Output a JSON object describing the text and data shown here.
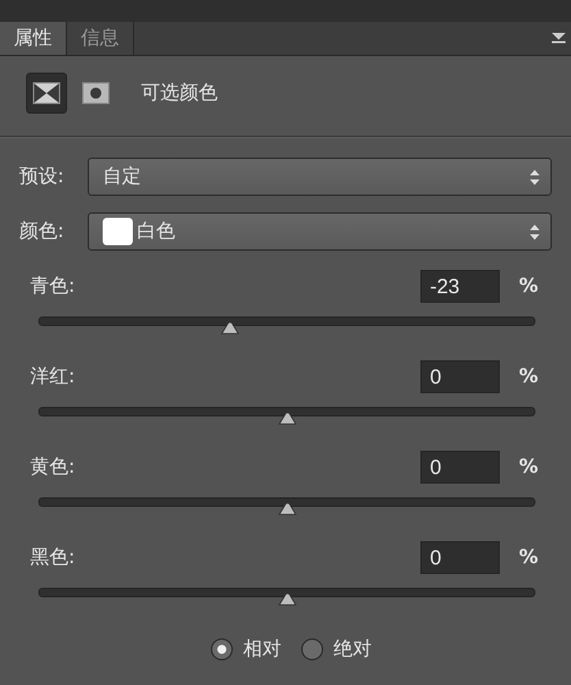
{
  "tabs": [
    {
      "label": "属性",
      "selected": true
    },
    {
      "label": "信息",
      "selected": false
    }
  ],
  "header": {
    "modes": [
      {
        "kind": "adjustment",
        "selected": true
      },
      {
        "kind": "mask",
        "selected": false
      }
    ],
    "title": "可选颜色"
  },
  "preset": {
    "label": "预设:",
    "value": "自定"
  },
  "colors": {
    "label": "颜色:",
    "value": "白色"
  },
  "sliders": [
    {
      "name": "青色:",
      "value": "-23",
      "unit": "%",
      "level": 0.385
    },
    {
      "name": "洋红:",
      "value": "0",
      "unit": "%",
      "level": 0.5
    },
    {
      "name": "黄色:",
      "value": "0",
      "unit": "%",
      "level": 0.5
    },
    {
      "name": "黑色:",
      "value": "0",
      "unit": "%",
      "level": 0.5
    }
  ],
  "method": [
    {
      "label": "相对",
      "selected": true
    },
    {
      "label": "绝对",
      "selected": false
    }
  ]
}
